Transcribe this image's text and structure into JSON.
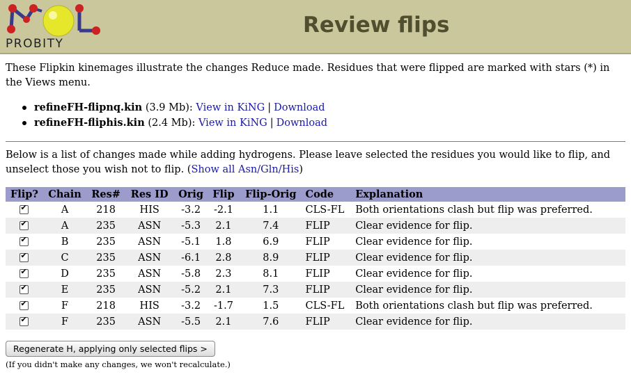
{
  "header": {
    "logo_text": "PROBITY",
    "title": "Review flips"
  },
  "intro": "These Flipkin kinemages illustrate the changes Reduce made. Residues that were flipped are marked with stars (*) in the Views menu.",
  "kinemages": [
    {
      "name": "refineFH-flipnq.kin",
      "size": "(3.9 Mb):",
      "view_label": "View in KiNG",
      "separator": "|",
      "download_label": "Download"
    },
    {
      "name": "refineFH-fliphis.kin",
      "size": "(2.4 Mb):",
      "view_label": "View in KiNG",
      "separator": "|",
      "download_label": "Download"
    }
  ],
  "list_intro": "Below is a list of changes made while adding hydrogens. Please leave selected the residues you would like to flip, and unselect those you wish not to flip.",
  "show_all_paren_open": "(",
  "show_all_label": "Show all Asn/Gln/His",
  "show_all_paren_close": ")",
  "table": {
    "headers": [
      "Flip?",
      "Chain",
      "Res#",
      "Res ID",
      "Orig",
      "Flip",
      "Flip-Orig",
      "Code",
      "Explanation"
    ],
    "rows": [
      {
        "flip": true,
        "chain": "A",
        "res": "218",
        "resid": "HIS",
        "orig": "-3.2",
        "flipval": "-2.1",
        "diff": "1.1",
        "code": "CLS-FL",
        "expl": "Both orientations clash but flip was preferred."
      },
      {
        "flip": true,
        "chain": "A",
        "res": "235",
        "resid": "ASN",
        "orig": "-5.3",
        "flipval": "2.1",
        "diff": "7.4",
        "code": "FLIP",
        "expl": "Clear evidence for flip."
      },
      {
        "flip": true,
        "chain": "B",
        "res": "235",
        "resid": "ASN",
        "orig": "-5.1",
        "flipval": "1.8",
        "diff": "6.9",
        "code": "FLIP",
        "expl": "Clear evidence for flip."
      },
      {
        "flip": true,
        "chain": "C",
        "res": "235",
        "resid": "ASN",
        "orig": "-6.1",
        "flipval": "2.8",
        "diff": "8.9",
        "code": "FLIP",
        "expl": "Clear evidence for flip."
      },
      {
        "flip": true,
        "chain": "D",
        "res": "235",
        "resid": "ASN",
        "orig": "-5.8",
        "flipval": "2.3",
        "diff": "8.1",
        "code": "FLIP",
        "expl": "Clear evidence for flip."
      },
      {
        "flip": true,
        "chain": "E",
        "res": "235",
        "resid": "ASN",
        "orig": "-5.2",
        "flipval": "2.1",
        "diff": "7.3",
        "code": "FLIP",
        "expl": "Clear evidence for flip."
      },
      {
        "flip": true,
        "chain": "F",
        "res": "218",
        "resid": "HIS",
        "orig": "-3.2",
        "flipval": "-1.7",
        "diff": "1.5",
        "code": "CLS-FL",
        "expl": "Both orientations clash but flip was preferred."
      },
      {
        "flip": true,
        "chain": "F",
        "res": "235",
        "resid": "ASN",
        "orig": "-5.5",
        "flipval": "2.1",
        "diff": "7.6",
        "code": "FLIP",
        "expl": "Clear evidence for flip."
      }
    ]
  },
  "regenerate_button": "Regenerate H, applying only selected flips >",
  "note": "(If you didn't make any changes, we won't recalculate.)"
}
